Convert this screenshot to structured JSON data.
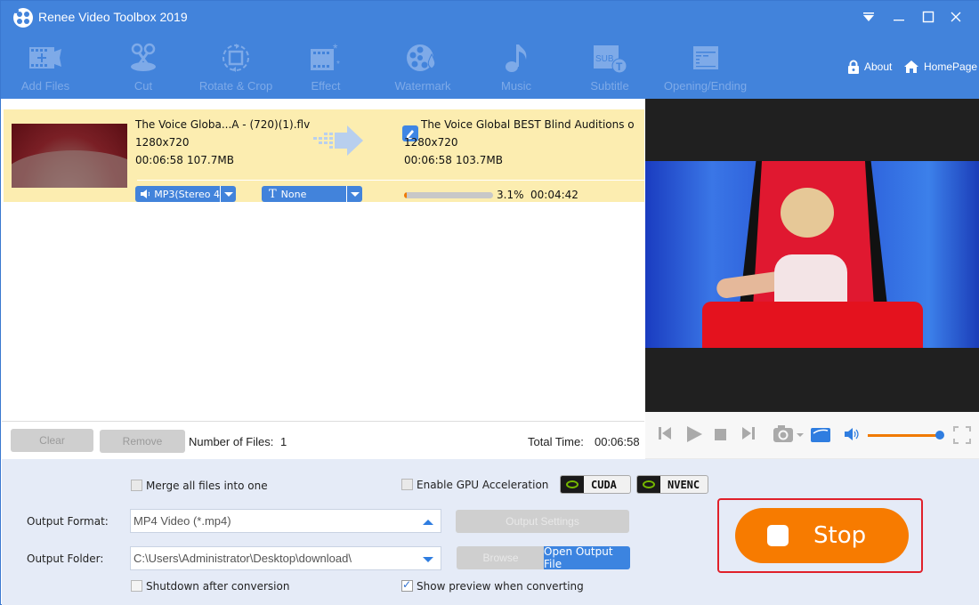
{
  "window": {
    "title": "Renee Video Toolbox 2019",
    "controls": [
      "menu",
      "minimize",
      "maximize",
      "close"
    ]
  },
  "toolbar": {
    "items": [
      {
        "label": "Add Files",
        "icon": "add-files-icon"
      },
      {
        "label": "Cut",
        "icon": "scissors-icon"
      },
      {
        "label": "Rotate & Crop",
        "icon": "rotate-crop-icon"
      },
      {
        "label": "Effect",
        "icon": "effect-icon"
      },
      {
        "label": "Watermark",
        "icon": "watermark-icon"
      },
      {
        "label": "Music",
        "icon": "music-note-icon"
      },
      {
        "label": "Subtitle",
        "icon": "subtitle-icon"
      },
      {
        "label": "Opening/Ending",
        "icon": "opening-ending-icon"
      }
    ],
    "about_label": "About",
    "homepage_label": "HomePage"
  },
  "file_list": {
    "items": [
      {
        "source_name": "The Voice Globa...A - (720)(1).flv",
        "source_resolution": "1280x720",
        "source_duration": "00:06:58",
        "source_size": "107.7MB",
        "audio_track": "MP3(Stereo 4",
        "subtitle_track": "None",
        "output_name": "The Voice Global  BEST Blind Auditions o",
        "output_resolution": "1280x720",
        "output_duration": "00:06:58",
        "output_size": "103.7MB",
        "progress_percent": 3.1,
        "progress_label": "3.1%",
        "remaining_time": "00:04:42"
      }
    ]
  },
  "list_footer": {
    "clear_label": "Clear",
    "remove_label": "Remove",
    "file_count_label": "Number of Files:",
    "file_count": "1",
    "total_time_label": "Total Time:",
    "total_time": "00:06:58"
  },
  "player": {
    "volume_percent": 100,
    "controls": [
      "previous",
      "play",
      "stop",
      "next",
      "snapshot",
      "open-folder",
      "volume",
      "fullscreen"
    ]
  },
  "settings": {
    "merge_label": "Merge all files into one",
    "merge_checked": false,
    "gpu_label": "Enable GPU Acceleration",
    "gpu_checked": false,
    "cuda_label": "CUDA",
    "nvenc_label": "NVENC",
    "output_format_label": "Output Format:",
    "output_format_value": "MP4 Video (*.mp4)",
    "output_settings_label": "Output Settings",
    "output_folder_label": "Output Folder:",
    "output_folder_value": "C:\\Users\\Administrator\\Desktop\\download\\",
    "browse_label": "Browse",
    "open_output_label": "Open Output File",
    "shutdown_label": "Shutdown after conversion",
    "shutdown_checked": false,
    "preview_label": "Show preview when converting",
    "preview_checked": true
  },
  "action": {
    "stop_label": "Stop"
  },
  "colors": {
    "titlebar": "#4283db",
    "accent_orange": "#f77b00",
    "row_highlight": "#fcedb0",
    "settings_bg": "#e5ebf7"
  }
}
